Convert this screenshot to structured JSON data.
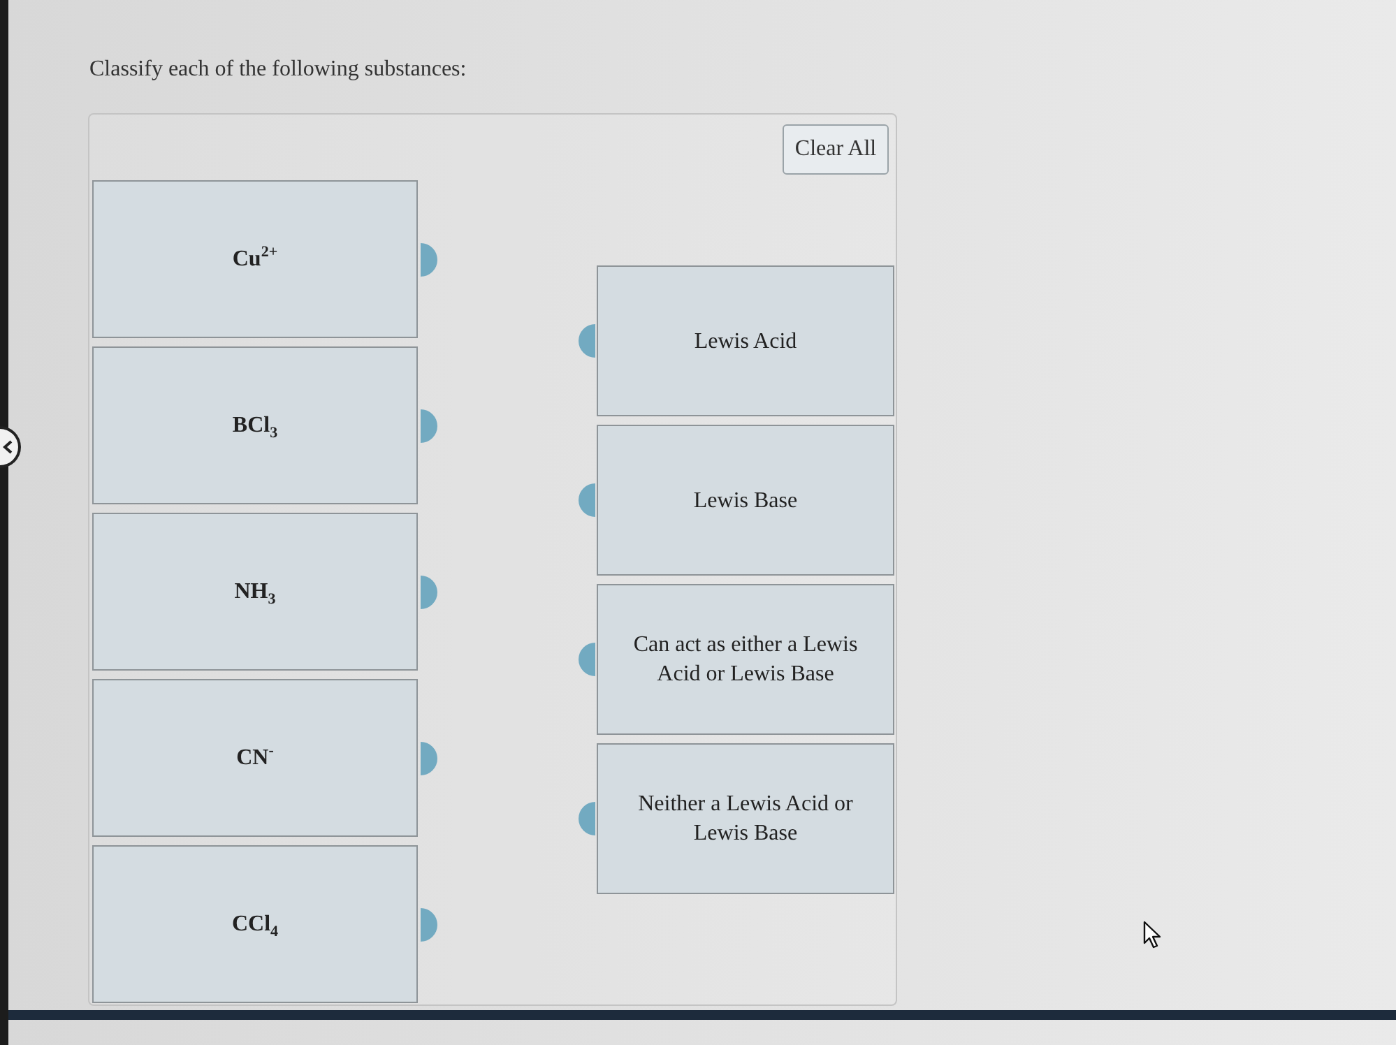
{
  "prompt": {
    "text": "Classify each of the following substances:"
  },
  "clear_button": {
    "label": "Clear All"
  },
  "substances": [
    {
      "label": "Cu$^{2+}$"
    },
    {
      "label": "BCl$_{3}$"
    },
    {
      "label": "NH$_{3}$"
    },
    {
      "label": "CN$^{-}$"
    },
    {
      "label": "CCl$_{4}$"
    }
  ],
  "categories": [
    {
      "label": "Lewis Acid"
    },
    {
      "label": "Lewis Base"
    },
    {
      "label": "Can act as either a Lewis Acid or Lewis Base"
    },
    {
      "label": "Neither a Lewis Acid or Lewis Base"
    }
  ]
}
